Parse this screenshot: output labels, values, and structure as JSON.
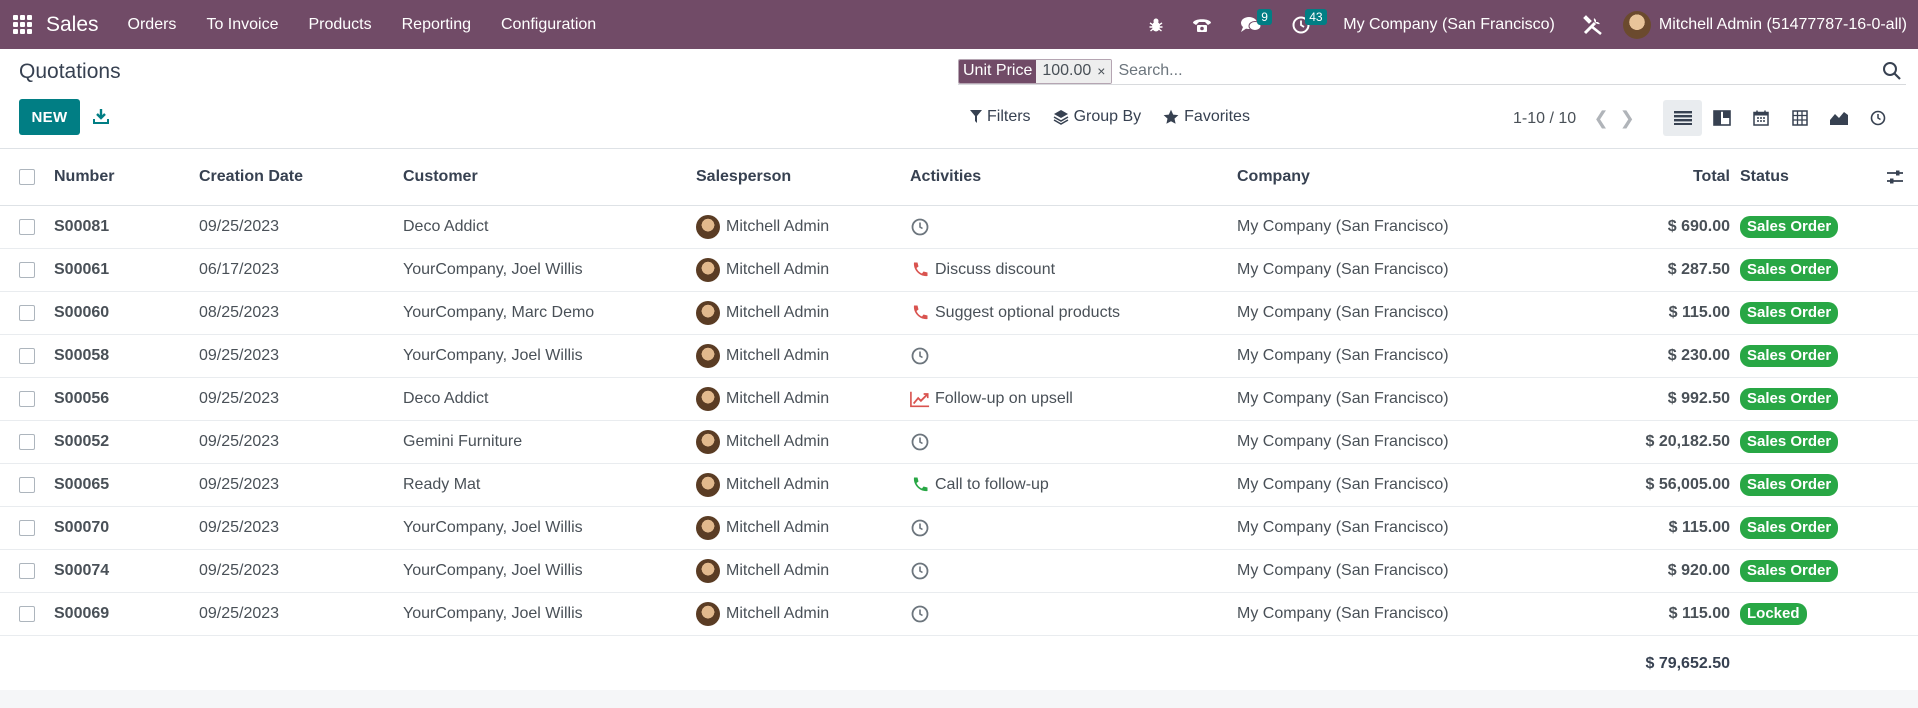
{
  "navbar": {
    "brand": "Sales",
    "menu": [
      "Orders",
      "To Invoice",
      "Products",
      "Reporting",
      "Configuration"
    ],
    "messages_count": "9",
    "activities_count": "43",
    "company": "My Company (San Francisco)",
    "user": "Mitchell Admin (51477787-16-0-all)",
    "bg_color": "#714b67"
  },
  "control": {
    "title": "Quotations",
    "new_label": "NEW",
    "facet_label": "Unit Price",
    "facet_value": "100.00",
    "facet_remove": "×",
    "search_placeholder": "Search...",
    "filters_label": "Filters",
    "groupby_label": "Group By",
    "favorites_label": "Favorites",
    "pager": "1-10 / 10"
  },
  "table": {
    "headers": {
      "number": "Number",
      "date": "Creation Date",
      "customer": "Customer",
      "salesperson": "Salesperson",
      "activities": "Activities",
      "company": "Company",
      "total": "Total",
      "status": "Status"
    },
    "rows": [
      {
        "number": "S00081",
        "date": "09/25/2023",
        "customer": "Deco Addict",
        "salesperson": "Mitchell Admin",
        "activity": "",
        "activity_icon": "clock-icon",
        "company": "My Company (San Francisco)",
        "total": "$ 690.00",
        "status": "Sales Order"
      },
      {
        "number": "S00061",
        "date": "06/17/2023",
        "customer": "YourCompany, Joel Willis",
        "salesperson": "Mitchell Admin",
        "activity": "Discuss discount",
        "activity_icon": "phone-red-icon",
        "company": "My Company (San Francisco)",
        "total": "$ 287.50",
        "status": "Sales Order"
      },
      {
        "number": "S00060",
        "date": "08/25/2023",
        "customer": "YourCompany, Marc Demo",
        "salesperson": "Mitchell Admin",
        "activity": "Suggest optional products",
        "activity_icon": "phone-red-icon",
        "company": "My Company (San Francisco)",
        "total": "$ 115.00",
        "status": "Sales Order"
      },
      {
        "number": "S00058",
        "date": "09/25/2023",
        "customer": "YourCompany, Joel Willis",
        "salesperson": "Mitchell Admin",
        "activity": "",
        "activity_icon": "clock-icon",
        "company": "My Company (San Francisco)",
        "total": "$ 230.00",
        "status": "Sales Order"
      },
      {
        "number": "S00056",
        "date": "09/25/2023",
        "customer": "Deco Addict",
        "salesperson": "Mitchell Admin",
        "activity": "Follow-up on upsell",
        "activity_icon": "upsell-chart-icon",
        "company": "My Company (San Francisco)",
        "total": "$ 992.50",
        "status": "Sales Order"
      },
      {
        "number": "S00052",
        "date": "09/25/2023",
        "customer": "Gemini Furniture",
        "salesperson": "Mitchell Admin",
        "activity": "",
        "activity_icon": "clock-icon",
        "company": "My Company (San Francisco)",
        "total": "$ 20,182.50",
        "status": "Sales Order"
      },
      {
        "number": "S00065",
        "date": "09/25/2023",
        "customer": "Ready Mat",
        "salesperson": "Mitchell Admin",
        "activity": "Call to follow-up",
        "activity_icon": "phone-green-icon",
        "company": "My Company (San Francisco)",
        "total": "$ 56,005.00",
        "status": "Sales Order"
      },
      {
        "number": "S00070",
        "date": "09/25/2023",
        "customer": "YourCompany, Joel Willis",
        "salesperson": "Mitchell Admin",
        "activity": "",
        "activity_icon": "clock-icon",
        "company": "My Company (San Francisco)",
        "total": "$ 115.00",
        "status": "Sales Order"
      },
      {
        "number": "S00074",
        "date": "09/25/2023",
        "customer": "YourCompany, Joel Willis",
        "salesperson": "Mitchell Admin",
        "activity": "",
        "activity_icon": "clock-icon",
        "company": "My Company (San Francisco)",
        "total": "$ 920.00",
        "status": "Sales Order"
      },
      {
        "number": "S00069",
        "date": "09/25/2023",
        "customer": "YourCompany, Joel Willis",
        "salesperson": "Mitchell Admin",
        "activity": "",
        "activity_icon": "clock-icon",
        "company": "My Company (San Francisco)",
        "total": "$ 115.00",
        "status": "Locked"
      }
    ],
    "grand_total": "$ 79,652.50"
  },
  "colors": {
    "primary": "#017e84",
    "status_green": "#28a745",
    "activity_red": "#d9534f",
    "activity_green": "#28a745"
  }
}
